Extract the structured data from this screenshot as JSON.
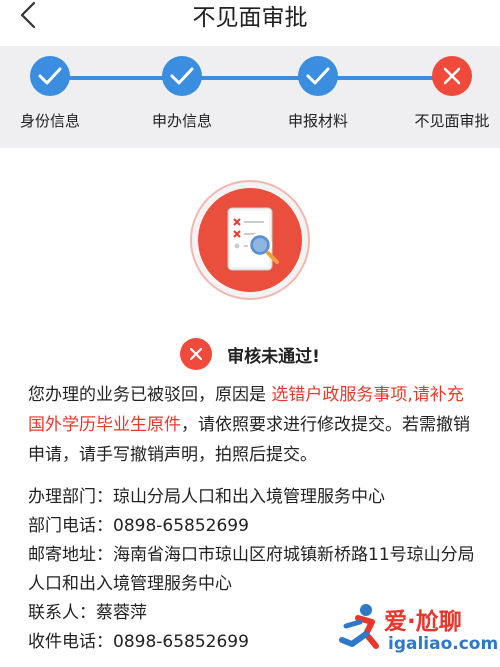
{
  "header": {
    "title": "不见面审批"
  },
  "steps": [
    {
      "label": "身份信息",
      "state": "done"
    },
    {
      "label": "申办信息",
      "state": "done"
    },
    {
      "label": "申报材料",
      "state": "done"
    },
    {
      "label": "不见面审批",
      "state": "failed"
    }
  ],
  "colors": {
    "accent_blue": "#3b8de0",
    "error_red": "#ef4a3c",
    "highlight_red": "#e53a2c"
  },
  "status": {
    "text": "审核未通过!",
    "icon": "error-x-icon"
  },
  "message": {
    "part1": "您办理的业务已被驳回，原因是 ",
    "reason": "选错户政服务事项,请补充国外学历毕业生原件",
    "part2": "，请依照要求进行修改提交。若需撤销申请，请手写撤销声明，拍照后提交。"
  },
  "info": [
    {
      "label": "办理部门：",
      "value": "琼山分局人口和出入境管理服务中心"
    },
    {
      "label": "部门电话：",
      "value": "0898-65852699"
    },
    {
      "label": "邮寄地址：",
      "value": "海南省海口市琼山区府城镇新桥路11号琼山分局人口和出入境管理服务中心"
    },
    {
      "label": "联系人：",
      "value": "蔡蓉萍"
    },
    {
      "label": "收件电话：",
      "value": "0898-65852699"
    }
  ],
  "watermark": {
    "title": "爱·尬聊",
    "url": "igaliao.com"
  }
}
